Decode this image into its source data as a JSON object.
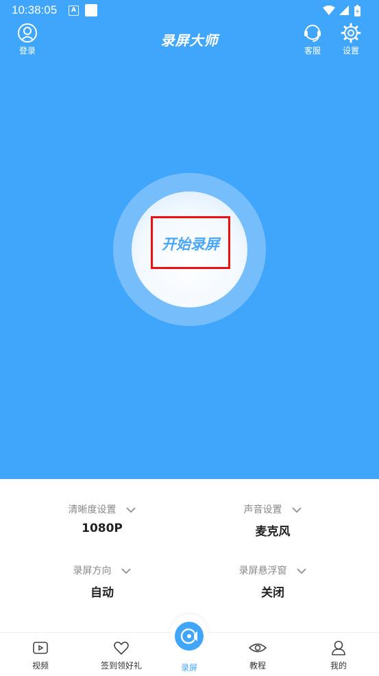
{
  "status_bar": {
    "time": "10:38:05",
    "a_badge": "A"
  },
  "header": {
    "title": "录屏大师",
    "login_label": "登录",
    "service_label": "客服",
    "settings_label": "设置"
  },
  "main": {
    "start_label": "开始录屏"
  },
  "settings": {
    "clarity": {
      "label": "清晰度设置",
      "value": "1080P"
    },
    "sound": {
      "label": "声音设置",
      "value": "麦克风"
    },
    "direction": {
      "label": "录屏方向",
      "value": "自动"
    },
    "floating": {
      "label": "录屏悬浮窗",
      "value": "关闭"
    }
  },
  "nav": {
    "video": "视频",
    "signin": "签到领好礼",
    "record": "录屏",
    "tutorial": "教程",
    "mine": "我的"
  },
  "colors": {
    "primary": "#3fa6fb",
    "highlight": "#ee1010"
  }
}
